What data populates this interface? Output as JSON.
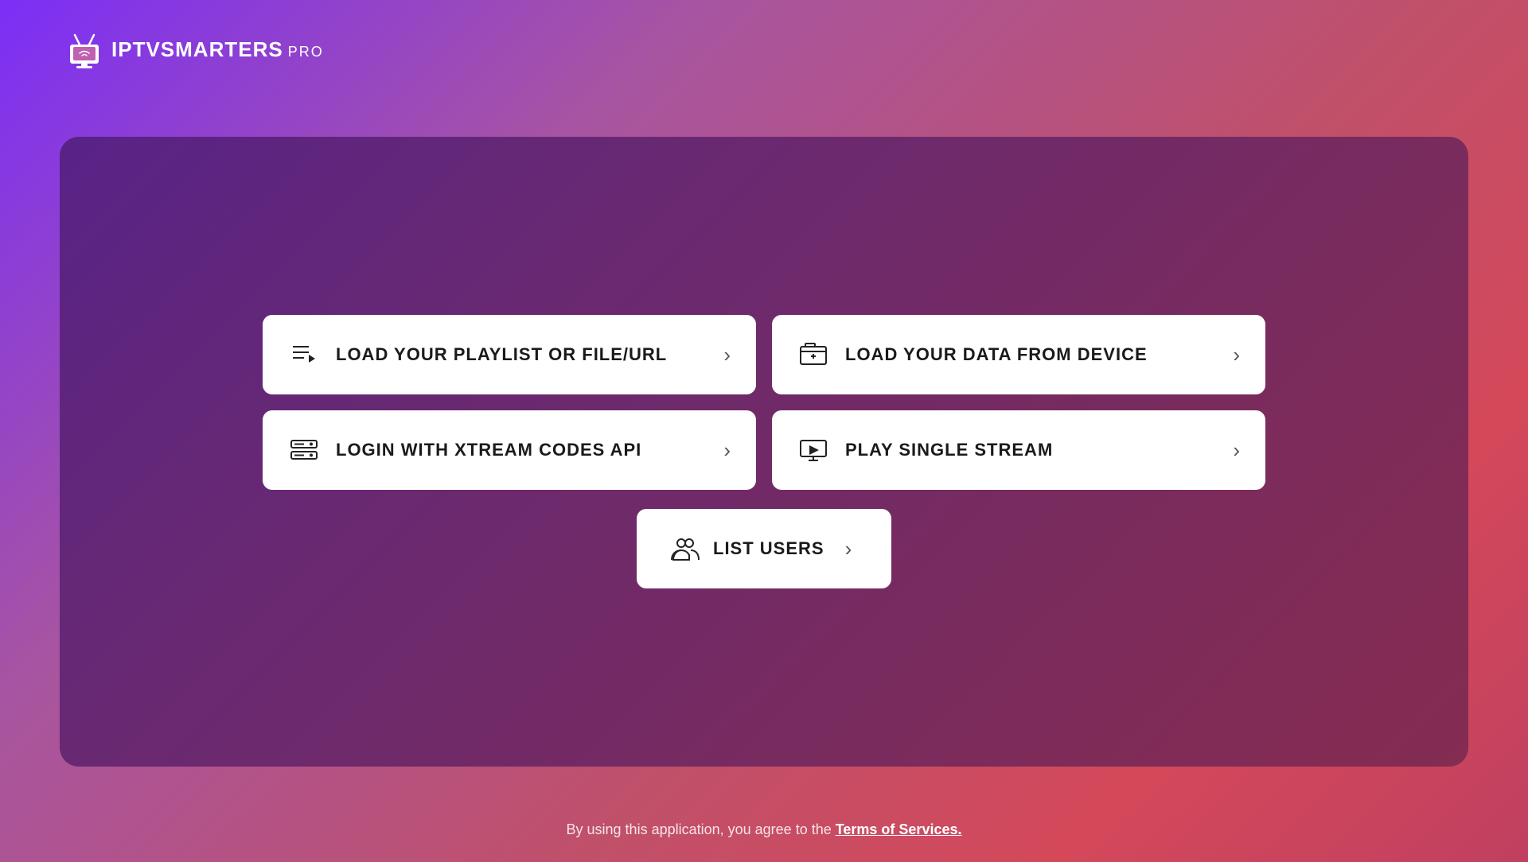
{
  "app": {
    "logo_iptv": "IPTV",
    "logo_smarters": "SMARTERS",
    "logo_pro": "PRO"
  },
  "menu": {
    "buttons": [
      {
        "id": "load-playlist",
        "label": "LOAD YOUR PLAYLIST OR FILE/URL",
        "icon": "playlist-icon"
      },
      {
        "id": "load-device",
        "label": "LOAD YOUR DATA FROM DEVICE",
        "icon": "device-icon"
      },
      {
        "id": "xtream-login",
        "label": "LOGIN WITH XTREAM CODES API",
        "icon": "xtream-icon"
      },
      {
        "id": "single-stream",
        "label": "PLAY SINGLE STREAM",
        "icon": "stream-icon"
      }
    ],
    "center_button": {
      "id": "list-users",
      "label": "LIST USERS",
      "icon": "users-icon"
    }
  },
  "footer": {
    "text": "By using this application, you agree to the ",
    "link_text": "Terms of Services."
  }
}
